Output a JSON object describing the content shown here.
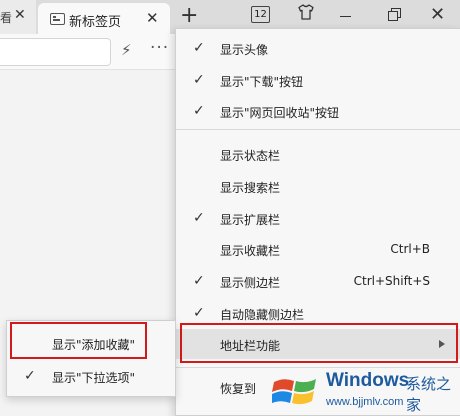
{
  "tabs": {
    "left_tab_label": "看",
    "left_tab_close": "✕",
    "active_tab_title": "新标签页",
    "active_tab_close": "✕",
    "new_tab": "+"
  },
  "titlebar": {
    "tab_count": "12",
    "skin_icon": "shirt-icon",
    "close_glyph": "✕"
  },
  "toolbar": {
    "bolt_glyph": "⚡",
    "more_glyph": "···"
  },
  "menu": {
    "check_glyph": "✓",
    "items": [
      {
        "label": "显示头像",
        "checked": true,
        "shortcut": ""
      },
      {
        "label": "显示\"下载\"按钮",
        "checked": true,
        "shortcut": ""
      },
      {
        "label": "显示\"网页回收站\"按钮",
        "checked": true,
        "shortcut": ""
      },
      {
        "label": "显示状态栏",
        "checked": false,
        "shortcut": ""
      },
      {
        "label": "显示搜索栏",
        "checked": false,
        "shortcut": ""
      },
      {
        "label": "显示扩展栏",
        "checked": true,
        "shortcut": ""
      },
      {
        "label": "显示收藏栏",
        "checked": false,
        "shortcut": "Ctrl+B"
      },
      {
        "label": "显示侧边栏",
        "checked": true,
        "shortcut": "Ctrl+Shift+S"
      },
      {
        "label": "自动隐藏侧边栏",
        "checked": true,
        "shortcut": ""
      },
      {
        "label": "地址栏功能",
        "checked": false,
        "shortcut": "",
        "submenu": true,
        "highlighted": true
      },
      {
        "label": "恢复到",
        "checked": false,
        "shortcut": ""
      }
    ]
  },
  "submenu": {
    "items": [
      {
        "label": "显示\"添加收藏\"",
        "checked": false
      },
      {
        "label": "显示\"下拉选项\"",
        "checked": true
      }
    ]
  },
  "watermark": {
    "title": "Windows",
    "cn": "系统之家",
    "url": "www.bjjmlv.com"
  },
  "colors": {
    "highlight_border": "#d31a1a",
    "watermark_blue": "#1d5a9e"
  }
}
